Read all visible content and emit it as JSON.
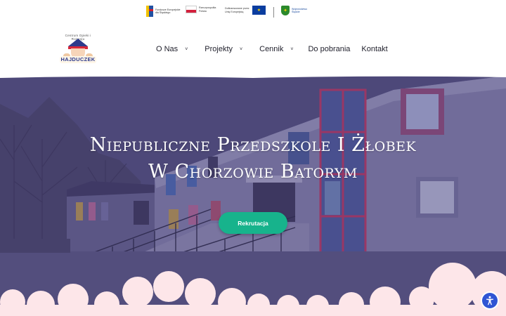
{
  "funding": {
    "fe_text": "Fundusze Europejskie dla Śląskiego",
    "pl_text": "Rzeczpospolita Polska",
    "eu_text": "Dofinansowane przez Unię Europejską",
    "region_text": "Województwo Śląskie"
  },
  "logo": {
    "arc_text": "Centrum Opieki i Rozwoju",
    "name": "HAJDUCZEK"
  },
  "nav": {
    "items": [
      {
        "label": "O Nas",
        "has_dropdown": true
      },
      {
        "label": "Projekty",
        "has_dropdown": true
      },
      {
        "label": "Cennik",
        "has_dropdown": true
      },
      {
        "label": "Do pobrania",
        "has_dropdown": false
      },
      {
        "label": "Kontakt",
        "has_dropdown": false
      }
    ],
    "chevron": "˅"
  },
  "hero": {
    "title_line1": "Niepubliczne Przedszkole I Żłobek",
    "title_line2": "W Chorzowie Batorym",
    "button_label": "Rekrutacja"
  },
  "colors": {
    "overlay": "#4a4673",
    "button": "#17b38c",
    "clouds": "#fde6e9",
    "a11y": "#2f55d4"
  },
  "icons": {
    "accessibility": "accessibility-icon"
  }
}
